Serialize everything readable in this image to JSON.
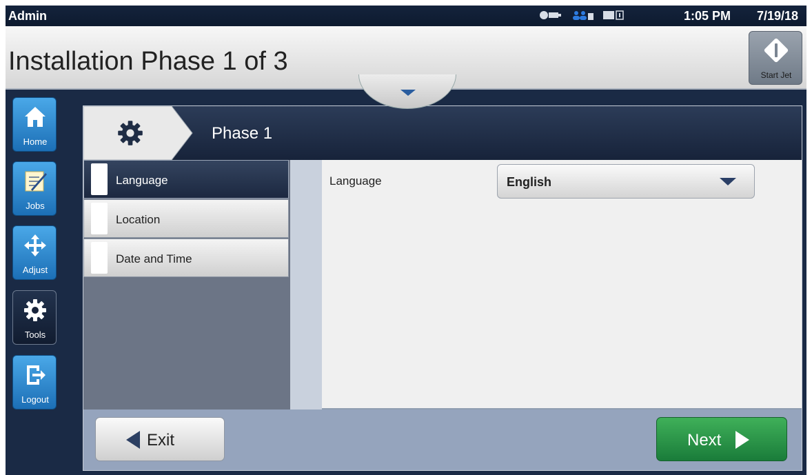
{
  "status_bar": {
    "user": "Admin",
    "time": "1:05 PM",
    "date": "7/19/18",
    "icons": [
      "ink-cartridge-icon",
      "network-icon",
      "memory-icon"
    ]
  },
  "header": {
    "title": "Installation Phase 1 of 3",
    "start_jet_label": "Start Jet"
  },
  "sidebar": {
    "items": [
      {
        "label": "Home",
        "icon": "home-icon"
      },
      {
        "label": "Jobs",
        "icon": "jobs-icon"
      },
      {
        "label": "Adjust",
        "icon": "move-arrows-icon"
      },
      {
        "label": "Tools",
        "icon": "gear-icon",
        "active": true
      },
      {
        "label": "Logout",
        "icon": "logout-icon"
      }
    ]
  },
  "phase": {
    "title": "Phase 1",
    "icon": "gear-icon"
  },
  "menu": {
    "items": [
      {
        "label": "Language",
        "selected": true
      },
      {
        "label": "Location"
      },
      {
        "label": "Date and Time"
      }
    ]
  },
  "content": {
    "field_label": "Language",
    "selected_value": "English"
  },
  "footer": {
    "exit_label": "Exit",
    "next_label": "Next"
  },
  "colors": {
    "accent_blue": "#1c6fb6",
    "next_green": "#2a9a48",
    "dark_navy": "#17233a"
  }
}
